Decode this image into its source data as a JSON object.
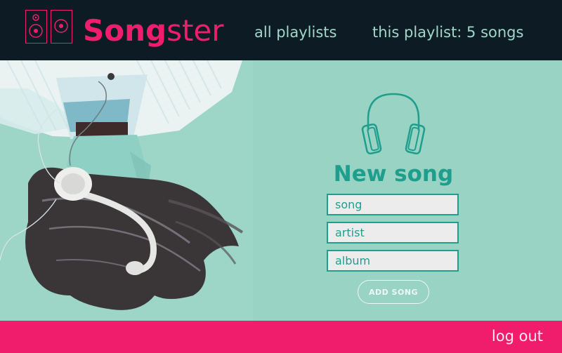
{
  "brand": {
    "name_bold": "Song",
    "name_light": "ster",
    "color": "#ef1d6b"
  },
  "nav": {
    "all_playlists": "all playlists",
    "this_playlist": "this playlist:  5 songs"
  },
  "form": {
    "title": "New song",
    "song_placeholder": "song",
    "artist_placeholder": "artist",
    "album_placeholder": "album",
    "submit_label": "ADD SONG"
  },
  "footer": {
    "logout_label": "log out"
  },
  "icons": {
    "logo": "speaker-icon",
    "form": "headphones-icon"
  },
  "colors": {
    "topbar": "#0d1c24",
    "accent_teal": "#1f9e8e",
    "background_mint": "#98d3c3",
    "footer": "#ef1d6b",
    "nav_text": "#9fd7c9"
  }
}
